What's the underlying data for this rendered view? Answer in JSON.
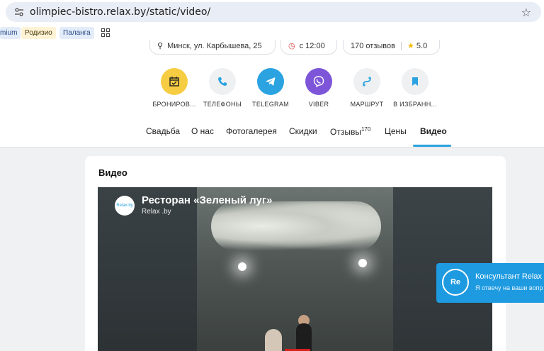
{
  "browser": {
    "url": "olimpiec-bistro.relax.by/static/video/",
    "bookmarks": [
      "mium",
      "Родизио",
      "Паланга"
    ]
  },
  "info": {
    "address": "Минск, ул. Карбышева, 25",
    "hours": "с 12:00",
    "reviews": "170 отзывов",
    "rating": "5.0"
  },
  "actions": [
    {
      "label": "БРОНИРОВ...",
      "icon": "calendar-check-icon"
    },
    {
      "label": "ТЕЛЕФОНЫ",
      "icon": "phone-icon"
    },
    {
      "label": "TELEGRAM",
      "icon": "telegram-icon"
    },
    {
      "label": "VIBER",
      "icon": "viber-icon"
    },
    {
      "label": "МАРШРУТ",
      "icon": "route-icon"
    },
    {
      "label": "В ИЗБРАНН...",
      "icon": "bookmark-icon"
    }
  ],
  "nav": {
    "items": [
      "Свадьба",
      "О нас",
      "Фотогалерея",
      "Скидки",
      "Отзывы",
      "Цены",
      "Видео"
    ],
    "reviews_count": "170",
    "active": "Видео"
  },
  "card": {
    "title": "Видео",
    "video_title": "Ресторан «Зеленый луг»",
    "video_channel": "Relax .by",
    "logo_text": "Relax.by"
  },
  "chat": {
    "avatar_text": "Re",
    "title": "Консультант Relax",
    "subtitle": "Я отвечу на ваши вопр"
  },
  "colors": {
    "accent": "#2aa3e0",
    "booking": "#f6cd42",
    "viber": "#7d55d8"
  }
}
